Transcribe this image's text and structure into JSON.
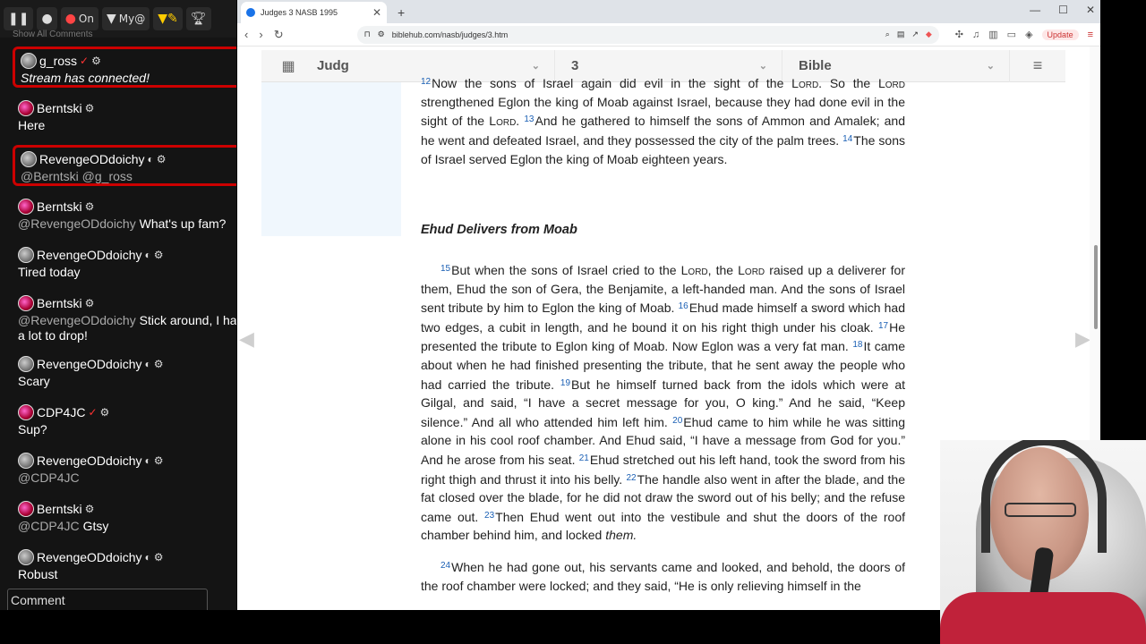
{
  "chat": {
    "top_chips": [
      {
        "icon": "pause-icon",
        "label": ""
      },
      {
        "icon": "speech-bubble-icon",
        "label": ""
      },
      {
        "icon": "record-dot-icon",
        "label": "On"
      },
      {
        "icon": "filter-icon",
        "label": "My@"
      },
      {
        "icon": "filter-pencil-icon",
        "label": ""
      },
      {
        "icon": "trophy-icon",
        "label": ""
      }
    ],
    "hint": "Show All Comments",
    "messages": [
      {
        "user": "g_ross",
        "text": "Stream has connected!",
        "highlight": true,
        "verified": true,
        "italic": true
      },
      {
        "user": "Berntski",
        "text": "Here",
        "highlight": false
      },
      {
        "user": "RevengeODdoichy",
        "mention": "@Berntski @g_ross",
        "text": "",
        "highlight": true
      },
      {
        "user": "Berntski",
        "mention": "@RevengeODdoichy",
        "text": "What's up fam?",
        "highlight": false
      },
      {
        "user": "RevengeODdoichy",
        "text": "Tired today",
        "highlight": false
      },
      {
        "user": "Berntski",
        "mention": "@RevengeODdoichy",
        "text": "Stick around, I have a lot to drop!",
        "highlight": false
      },
      {
        "user": "RevengeODdoichy",
        "text": "Scary",
        "highlight": false
      },
      {
        "user": "CDP4JC",
        "text": "Sup?",
        "highlight": false,
        "verified": true
      },
      {
        "user": "RevengeODdoichy",
        "mention": "@CDP4JC",
        "text": "",
        "highlight": false
      },
      {
        "user": "Berntski",
        "mention": "@CDP4JC",
        "text": "Gtsy",
        "highlight": false
      },
      {
        "user": "RevengeODdoichy",
        "text": "Robust",
        "highlight": false
      }
    ],
    "comment_placeholder": "Comment"
  },
  "browser": {
    "tab_title": "Judges 3 NASB 1995",
    "new_tab": "+",
    "url": "biblehub.com/nasb/judges/3.htm",
    "update_label": "Update"
  },
  "bible_nav": {
    "book": "Judg",
    "chapter": "3",
    "version": "Bible"
  },
  "passage": {
    "heading": "Ehud Delivers from Moab",
    "lord": "Lord"
  }
}
